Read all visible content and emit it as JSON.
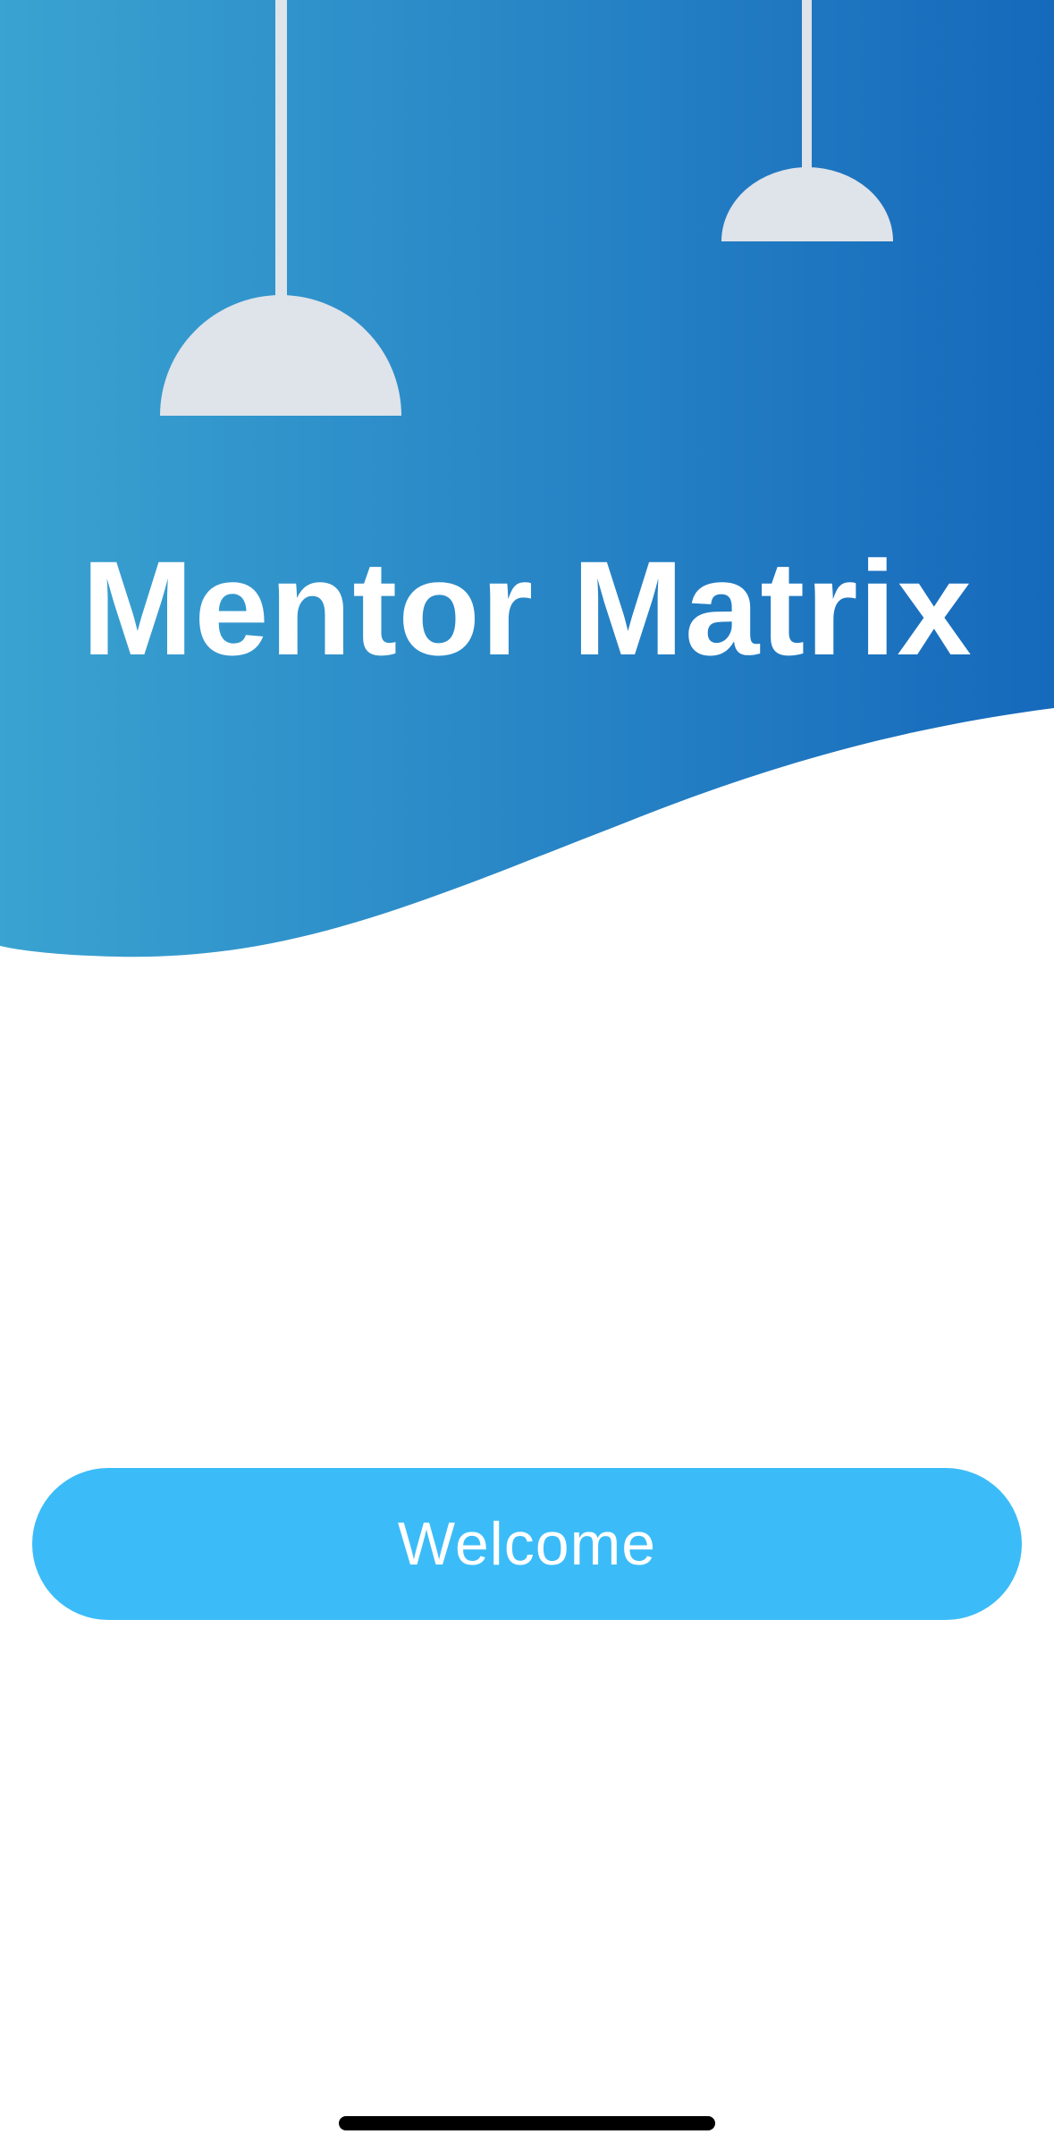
{
  "app": {
    "title": "Mentor Matrix"
  },
  "actions": {
    "welcome_label": "Welcome"
  },
  "colors": {
    "header_gradient_start": "#3aa3d1",
    "header_gradient_end": "#1669bb",
    "lamp_shade": "#dfe3ea",
    "button_background": "#3bbcf8",
    "title_text": "#ffffff",
    "button_text": "#ffffff",
    "background": "#ffffff"
  },
  "icons": {
    "left_lamp": "pendant-lamp-icon",
    "right_lamp": "pendant-lamp-icon",
    "home_indicator": "home-indicator-bar"
  }
}
